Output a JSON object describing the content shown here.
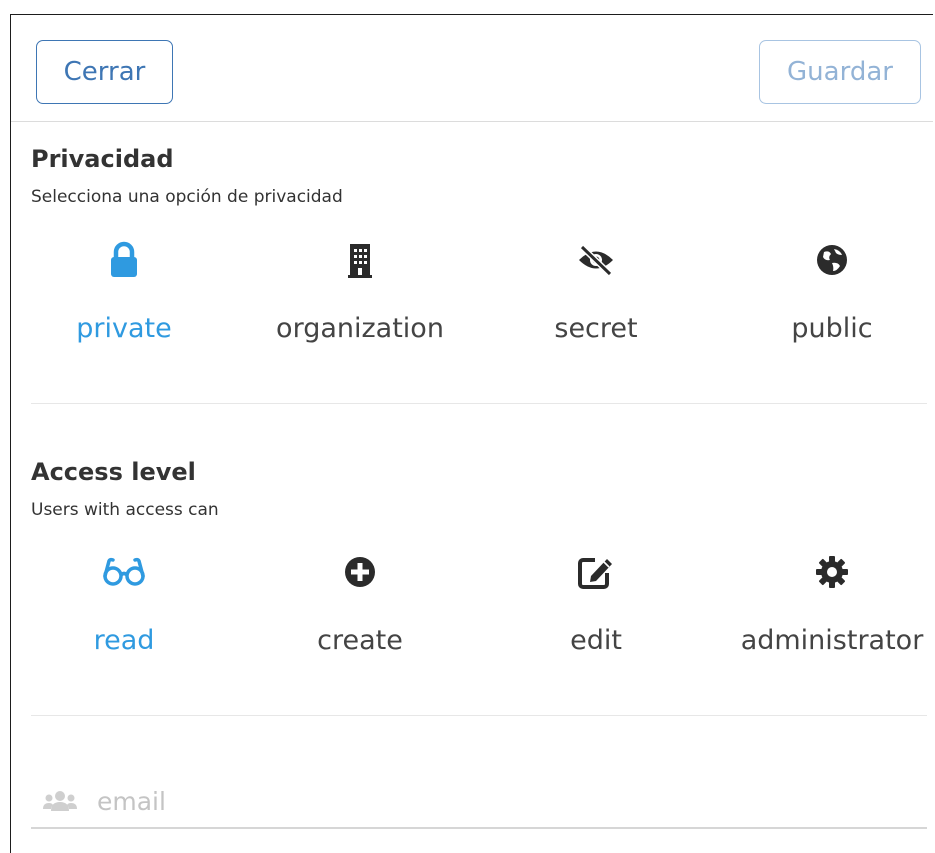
{
  "toolbar": {
    "close_label": "Cerrar",
    "save_label": "Guardar"
  },
  "privacy": {
    "title": "Privacidad",
    "subtitle": "Selecciona una opción de privacidad",
    "selected": "private",
    "options": [
      {
        "label": "private",
        "icon": "lock-icon"
      },
      {
        "label": "organization",
        "icon": "building-icon"
      },
      {
        "label": "secret",
        "icon": "eye-slash-icon"
      },
      {
        "label": "public",
        "icon": "globe-icon"
      }
    ]
  },
  "access": {
    "title": "Access level",
    "subtitle": "Users with access can",
    "selected": "read",
    "options": [
      {
        "label": "read",
        "icon": "glasses-icon"
      },
      {
        "label": "create",
        "icon": "plus-circle-icon"
      },
      {
        "label": "edit",
        "icon": "edit-icon"
      },
      {
        "label": "administrator",
        "icon": "gear-icon"
      }
    ]
  },
  "email": {
    "placeholder": "email",
    "value": "",
    "icon": "users-icon"
  },
  "colors": {
    "accent": "#2f9ae0",
    "button_border": "#3e76b4",
    "text": "#444444"
  }
}
